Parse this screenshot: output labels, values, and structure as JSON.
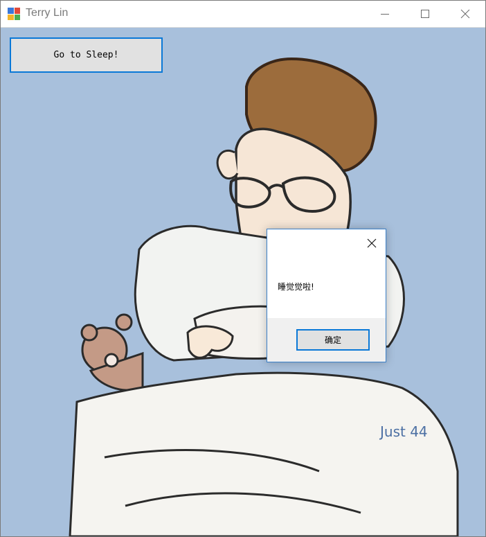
{
  "window": {
    "title": "Terry Lin",
    "icon": "winforms-app-icon",
    "controls": {
      "minimize": "minimize-icon",
      "maximize": "maximize-icon",
      "close": "close-icon"
    }
  },
  "main": {
    "sleep_button_label": "Go to Sleep!"
  },
  "artwork": {
    "signature_text": "Just 44"
  },
  "dialog": {
    "message": "睡觉觉啦!",
    "ok_label": "确定",
    "close_icon": "close-icon"
  },
  "colors": {
    "background": "#a8c0dc",
    "accent": "#0a78d7",
    "button_face": "#e1e1e1"
  }
}
